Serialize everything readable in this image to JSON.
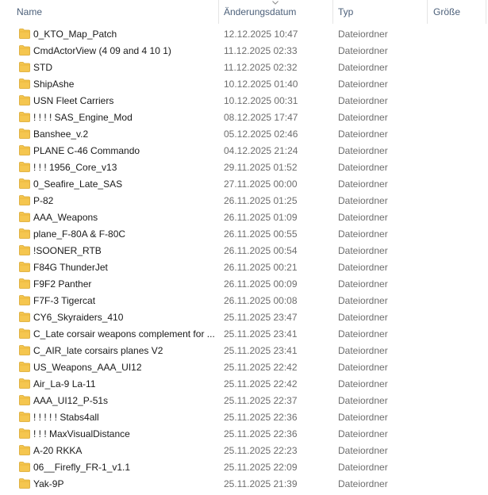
{
  "columns": {
    "name": "Name",
    "date": "Änderungsdatum",
    "type": "Typ",
    "size": "Größe"
  },
  "colors": {
    "header_text": "#4c607a",
    "folder_icon": "#f5c64f"
  },
  "rows": [
    {
      "name": "0_KTO_Map_Patch",
      "date": "12.12.2025 10:47",
      "type": "Dateiordner",
      "icon": "folder-icon"
    },
    {
      "name": "CmdActorView (4 09 and 4 10 1)",
      "date": "11.12.2025 02:33",
      "type": "Dateiordner",
      "icon": "folder-icon"
    },
    {
      "name": "STD",
      "date": "11.12.2025 02:32",
      "type": "Dateiordner",
      "icon": "folder-icon"
    },
    {
      "name": "ShipAshe",
      "date": "10.12.2025 01:40",
      "type": "Dateiordner",
      "icon": "folder-icon"
    },
    {
      "name": "USN Fleet Carriers",
      "date": "10.12.2025 00:31",
      "type": "Dateiordner",
      "icon": "folder-icon"
    },
    {
      "name": "! ! ! ! SAS_Engine_Mod",
      "date": "08.12.2025 17:47",
      "type": "Dateiordner",
      "icon": "folder-icon"
    },
    {
      "name": "Banshee_v.2",
      "date": "05.12.2025 02:46",
      "type": "Dateiordner",
      "icon": "folder-icon"
    },
    {
      "name": "PLANE C-46 Commando",
      "date": "04.12.2025 21:24",
      "type": "Dateiordner",
      "icon": "folder-icon"
    },
    {
      "name": "! ! ! 1956_Core_v13",
      "date": "29.11.2025 01:52",
      "type": "Dateiordner",
      "icon": "folder-icon"
    },
    {
      "name": "0_Seafire_Late_SAS",
      "date": "27.11.2025 00:00",
      "type": "Dateiordner",
      "icon": "folder-icon"
    },
    {
      "name": "P-82",
      "date": "26.11.2025 01:25",
      "type": "Dateiordner",
      "icon": "folder-icon"
    },
    {
      "name": "AAA_Weapons",
      "date": "26.11.2025 01:09",
      "type": "Dateiordner",
      "icon": "folder-icon"
    },
    {
      "name": "plane_F-80A & F-80C",
      "date": "26.11.2025 00:55",
      "type": "Dateiordner",
      "icon": "folder-icon"
    },
    {
      "name": "!SOONER_RTB",
      "date": "26.11.2025 00:54",
      "type": "Dateiordner",
      "icon": "folder-icon"
    },
    {
      "name": "F84G ThunderJet",
      "date": "26.11.2025 00:21",
      "type": "Dateiordner",
      "icon": "folder-icon"
    },
    {
      "name": "F9F2 Panther",
      "date": "26.11.2025 00:09",
      "type": "Dateiordner",
      "icon": "folder-icon"
    },
    {
      "name": "F7F-3 Tigercat",
      "date": "26.11.2025 00:08",
      "type": "Dateiordner",
      "icon": "folder-icon"
    },
    {
      "name": "CY6_Skyraiders_410",
      "date": "25.11.2025 23:47",
      "type": "Dateiordner",
      "icon": "folder-icon"
    },
    {
      "name": "C_Late corsair weapons complement for ...",
      "date": "25.11.2025 23:41",
      "type": "Dateiordner",
      "icon": "folder-icon"
    },
    {
      "name": "C_AIR_late corsairs planes V2",
      "date": "25.11.2025 23:41",
      "type": "Dateiordner",
      "icon": "folder-icon"
    },
    {
      "name": "US_Weapons_AAA_UI12",
      "date": "25.11.2025 22:42",
      "type": "Dateiordner",
      "icon": "folder-icon"
    },
    {
      "name": "Air_La-9 La-11",
      "date": "25.11.2025 22:42",
      "type": "Dateiordner",
      "icon": "folder-icon"
    },
    {
      "name": "AAA_UI12_P-51s",
      "date": "25.11.2025 22:37",
      "type": "Dateiordner",
      "icon": "folder-icon"
    },
    {
      "name": "! ! ! ! ! Stabs4all",
      "date": "25.11.2025 22:36",
      "type": "Dateiordner",
      "icon": "folder-icon"
    },
    {
      "name": "! ! ! MaxVisualDistance",
      "date": "25.11.2025 22:36",
      "type": "Dateiordner",
      "icon": "folder-icon"
    },
    {
      "name": "A-20 RKKA",
      "date": "25.11.2025 22:23",
      "type": "Dateiordner",
      "icon": "folder-icon"
    },
    {
      "name": "06__Firefly_FR-1_v1.1",
      "date": "25.11.2025 22:09",
      "type": "Dateiordner",
      "icon": "folder-icon"
    },
    {
      "name": "Yak-9P",
      "date": "25.11.2025 21:39",
      "type": "Dateiordner",
      "icon": "folder-icon"
    }
  ]
}
